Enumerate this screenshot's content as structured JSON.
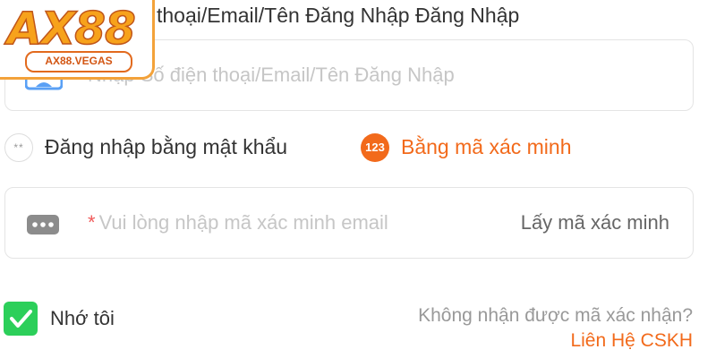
{
  "logo": {
    "brand": "AX88",
    "domain": "AX88.VEGAS"
  },
  "account": {
    "title": "thoại/Email/Tên Đăng Nhập Đăng Nhập",
    "placeholder": "Nhập Số điện thoại/Email/Tên Đăng Nhập",
    "icon": "user-card-icon"
  },
  "login_mode": {
    "password_label": "Đăng nhập bằng mật khẩu",
    "password_icon_text": "**",
    "code_label": "Bằng mã xác minh",
    "code_icon_text": "123"
  },
  "verification": {
    "required_mark": "*",
    "placeholder": "Vui lòng nhập mã xác minh email",
    "get_code_label": "Lấy mã xác minh",
    "icon": "dots-icon"
  },
  "remember": {
    "label": "Nhớ tôi",
    "checked": true
  },
  "help": {
    "text": "Không nhận được mã xác nhận?",
    "link_label": "Liên Hệ CSKH"
  },
  "colors": {
    "accent": "#f26a1b",
    "checkbox_green": "#2ccf5a",
    "logo_orange": "#f7a21b"
  }
}
